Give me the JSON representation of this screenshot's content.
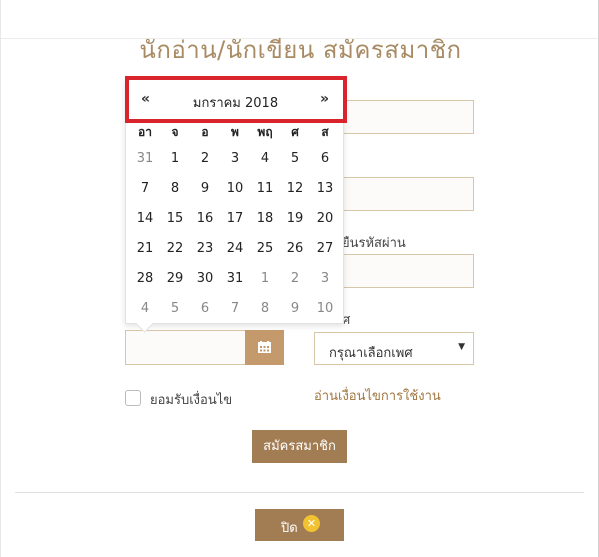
{
  "title": "นักอ่าน/นักเขียน สมัครสมาชิก",
  "form": {
    "confirm_password_label": "ยืนรหัสผ่าน",
    "gender_label_fragment": "ศ",
    "gender_select_value": "กรุณาเลือกเพศ",
    "accept_label": "ยอมรับเงื่อนไข",
    "terms_link": "อ่านเงื่อนไขการใช้งาน",
    "submit_label": "สมัครสมาชิก"
  },
  "footer": {
    "close_label": "ปิด",
    "close_icon": "✕"
  },
  "datepicker": {
    "prev": "«",
    "next": "»",
    "month_title": "มกราคม 2018",
    "weekdays": [
      "อา",
      "จ",
      "อ",
      "พ",
      "พฤ",
      "ศ",
      "ส"
    ],
    "weeks": [
      [
        "31",
        "1",
        "2",
        "3",
        "4",
        "5",
        "6"
      ],
      [
        "7",
        "8",
        "9",
        "10",
        "11",
        "12",
        "13"
      ],
      [
        "14",
        "15",
        "16",
        "17",
        "18",
        "19",
        "20"
      ],
      [
        "21",
        "22",
        "23",
        "24",
        "25",
        "26",
        "27"
      ],
      [
        "28",
        "29",
        "30",
        "31",
        "1",
        "2",
        "3"
      ],
      [
        "4",
        "5",
        "6",
        "7",
        "8",
        "9",
        "10"
      ]
    ],
    "muted": [
      [
        true,
        false,
        false,
        false,
        false,
        false,
        false
      ],
      [
        false,
        false,
        false,
        false,
        false,
        false,
        false
      ],
      [
        false,
        false,
        false,
        false,
        false,
        false,
        false
      ],
      [
        false,
        false,
        false,
        false,
        false,
        false,
        false
      ],
      [
        false,
        false,
        false,
        false,
        true,
        true,
        true
      ],
      [
        true,
        true,
        true,
        true,
        true,
        true,
        true
      ]
    ]
  },
  "colors": {
    "brand": "#a27c52",
    "accent_highlight": "#d9232d",
    "title": "#a88a63"
  }
}
